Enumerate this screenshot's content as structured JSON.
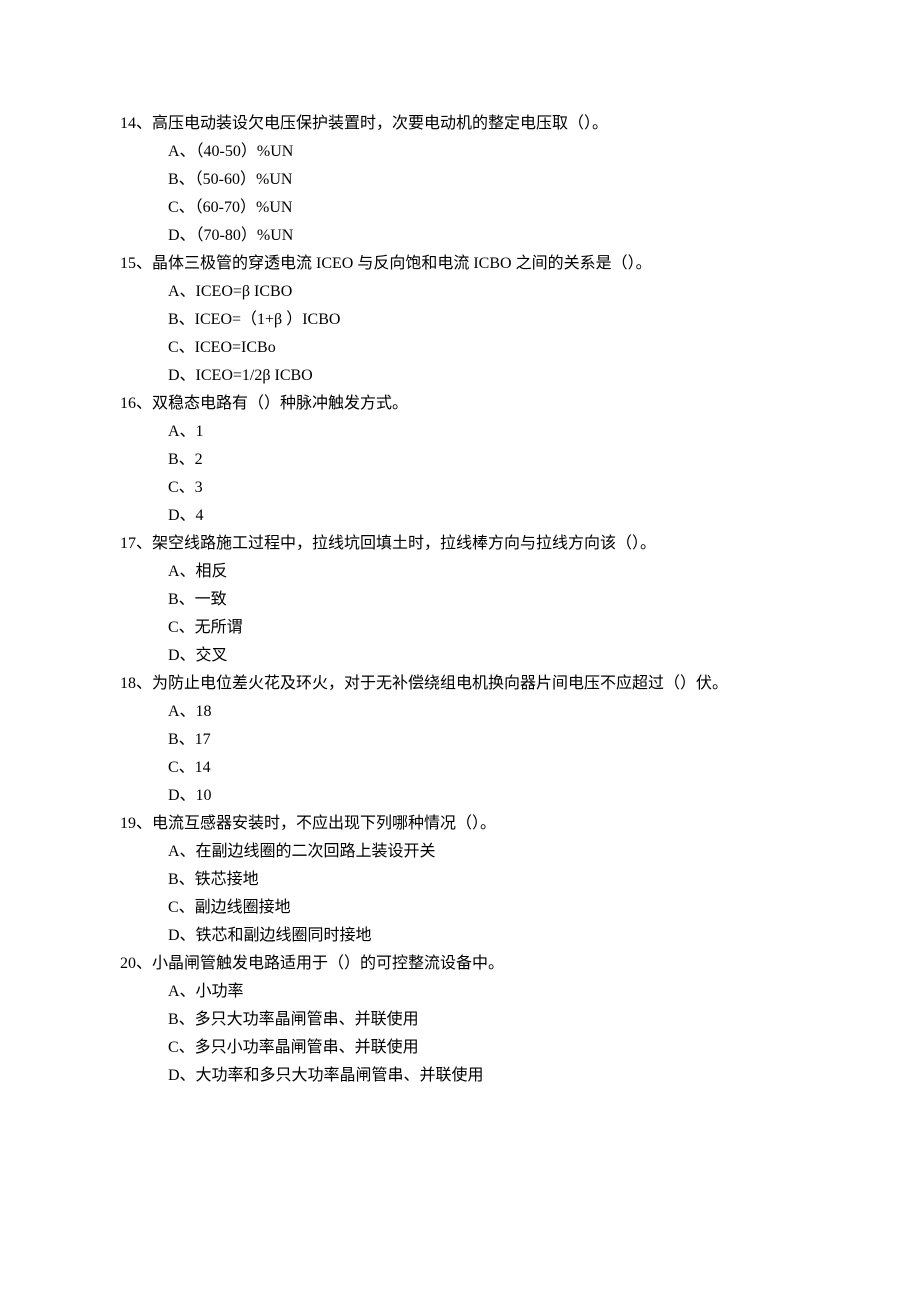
{
  "questions": [
    {
      "number": "14、",
      "text": "高压电动装设欠电压保护装置时，次要电动机的整定电压取（）。",
      "options": [
        "A、（40-50）%UN",
        "B、（50-60）%UN",
        "C、（60-70）%UN",
        "D、（70-80）%UN"
      ]
    },
    {
      "number": "15、",
      "text": "晶体三极管的穿透电流 ICEO 与反向饱和电流 ICBO 之间的关系是（）。",
      "options": [
        "A、ICEO=β ICBO",
        "B、ICEO=（1+β ）ICBO",
        "C、ICEO=ICBo",
        "D、ICEO=1/2β ICBO"
      ]
    },
    {
      "number": "16、",
      "text": "双稳态电路有（）种脉冲触发方式。",
      "options": [
        "A、1",
        "B、2",
        "C、3",
        "D、4"
      ]
    },
    {
      "number": "17、",
      "text": "架空线路施工过程中，拉线坑回填土时，拉线棒方向与拉线方向该（）。",
      "options": [
        "A、相反",
        "B、一致",
        "C、无所谓",
        "D、交叉"
      ]
    },
    {
      "number": "18、",
      "text": "为防止电位差火花及环火，对于无补偿绕组电机换向器片间电压不应超过（）伏。",
      "options": [
        "A、18",
        "B、17",
        "C、14",
        "D、10"
      ]
    },
    {
      "number": "19、",
      "text": "电流互感器安装时，不应出现下列哪种情况（）。",
      "options": [
        "A、在副边线圈的二次回路上装设开关",
        "B、铁芯接地",
        "C、副边线圈接地",
        "D、铁芯和副边线圈同时接地"
      ]
    },
    {
      "number": "20、",
      "text": "小晶闸管触发电路适用于（）的可控整流设备中。",
      "options": [
        "A、小功率",
        "B、多只大功率晶闸管串、并联使用",
        "C、多只小功率晶闸管串、并联使用",
        "D、大功率和多只大功率晶闸管串、并联使用"
      ]
    }
  ]
}
